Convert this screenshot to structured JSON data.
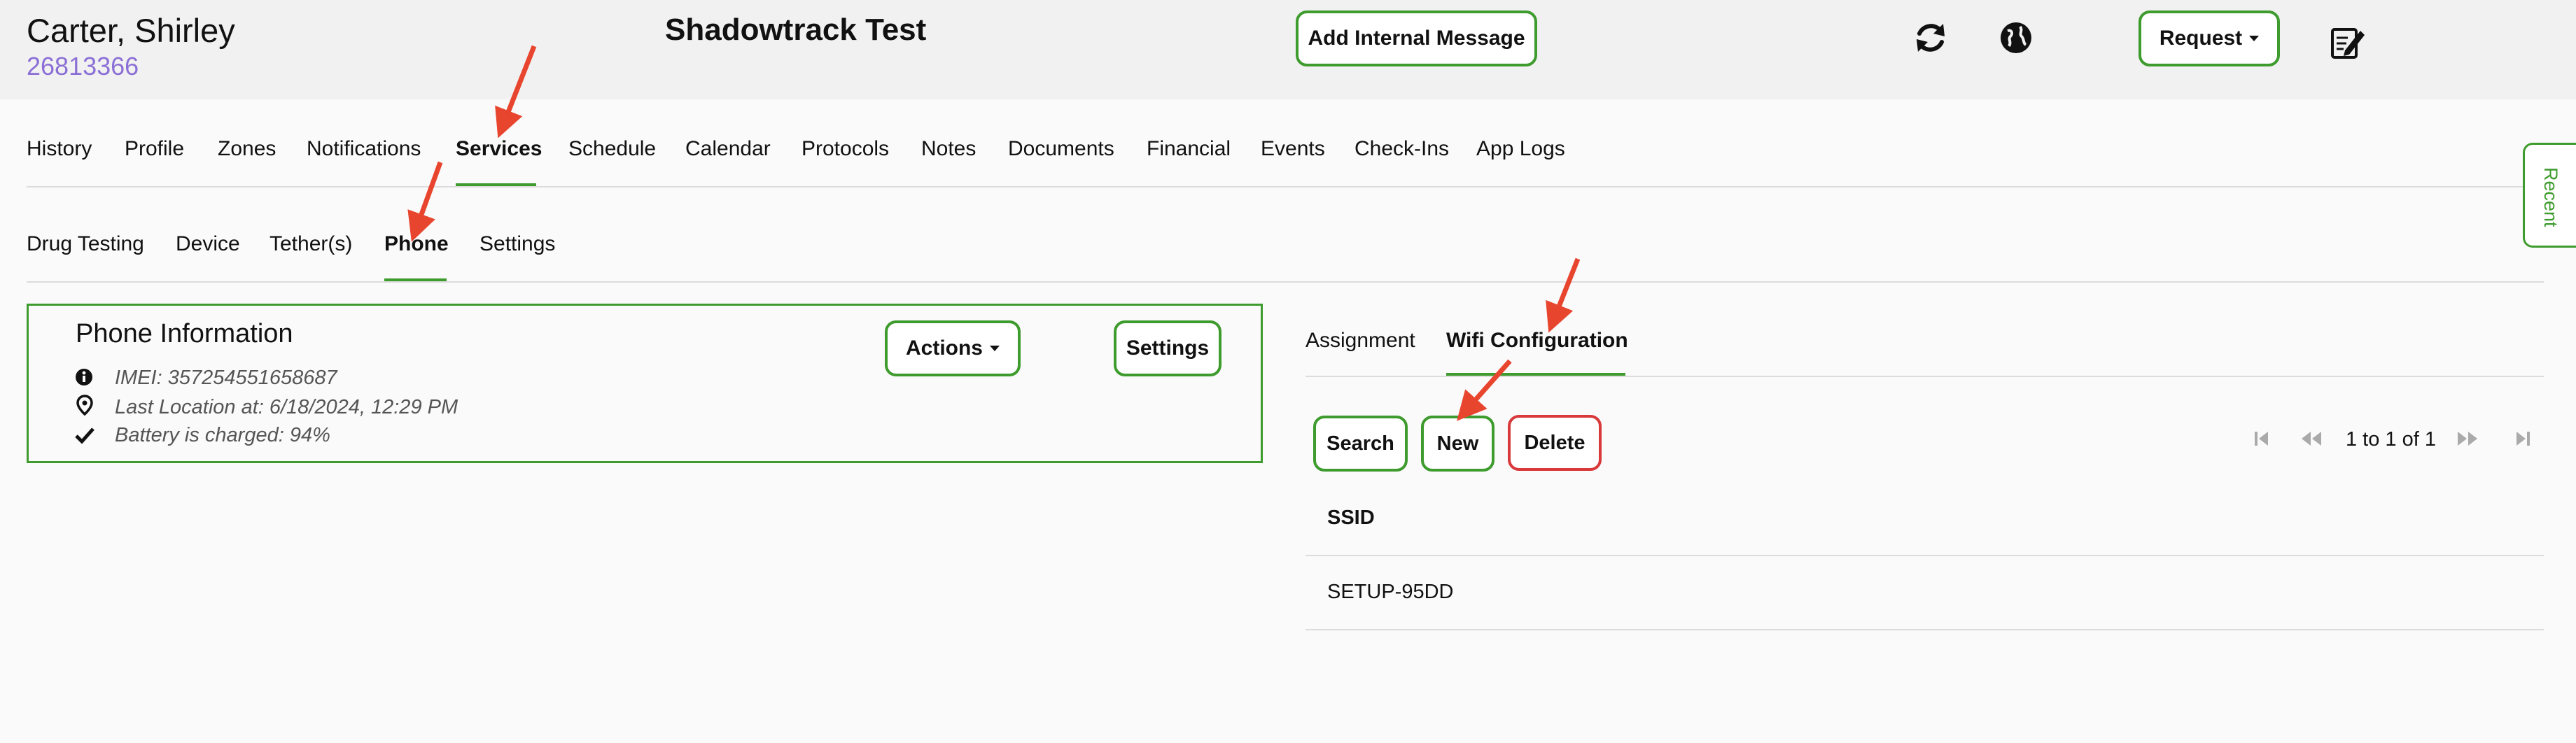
{
  "header": {
    "patient_name": "Carter, Shirley",
    "patient_id": "26813366",
    "center_title": "Shadowtrack Test",
    "add_message_label": "Add Internal Message",
    "request_label": "Request"
  },
  "main_nav": [
    "History",
    "Profile",
    "Zones",
    "Notifications",
    "Services",
    "Schedule",
    "Calendar",
    "Protocols",
    "Notes",
    "Documents",
    "Financial",
    "Events",
    "Check-Ins",
    "App Logs"
  ],
  "sub_nav": [
    "Drug Testing",
    "Device",
    "Tether(s)",
    "Phone",
    "Settings"
  ],
  "phone_info": {
    "title": "Phone Information",
    "actions_label": "Actions",
    "settings_label": "Settings",
    "imei": "IMEI: 357254551658687",
    "last_location": "Last Location at: 6/18/2024, 12:29 PM",
    "battery": "Battery is charged: 94%"
  },
  "right_tabs": [
    "Assignment",
    "Wifi Configuration"
  ],
  "wifi": {
    "search_label": "Search",
    "new_label": "New",
    "delete_label": "Delete",
    "pager_text": "1 to 1 of 1",
    "column_header": "SSID",
    "rows": [
      "SETUP-95DD"
    ]
  },
  "recent_tab": "Recent",
  "colors": {
    "accent": "#3e9b2d",
    "danger": "#d9393b",
    "id_purple": "#8b6fd6",
    "arrow": "#e8452f"
  }
}
